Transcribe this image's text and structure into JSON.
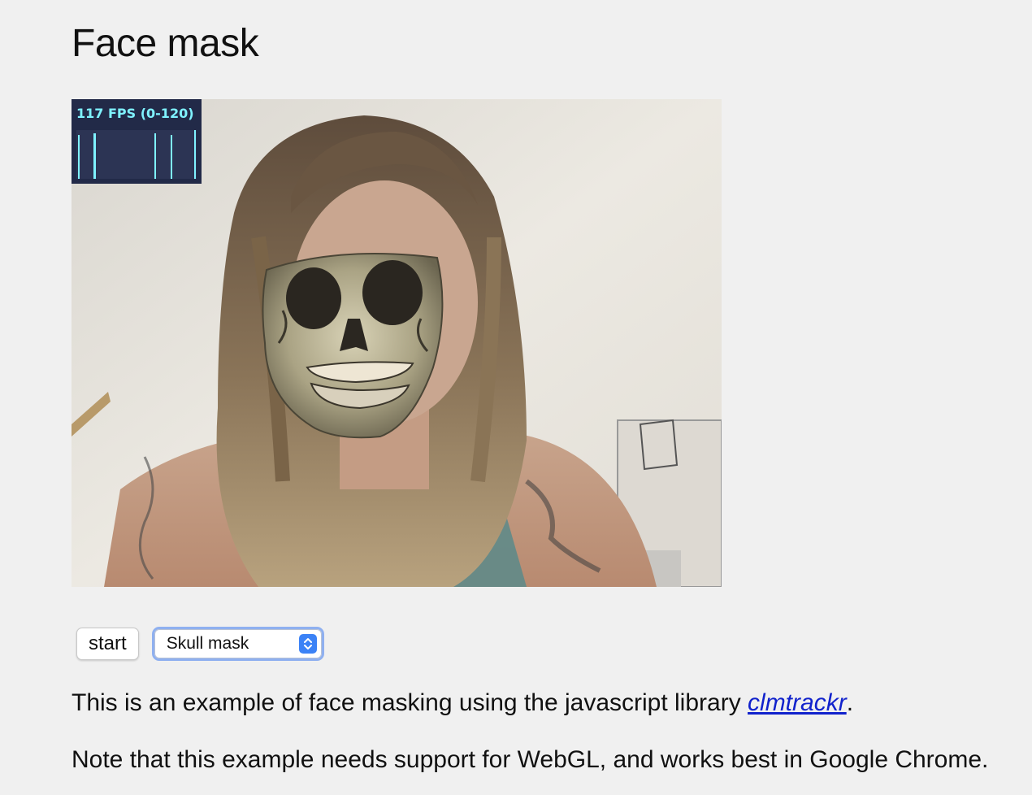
{
  "page": {
    "title": "Face mask"
  },
  "video": {
    "stats": {
      "fps_label": "117 FPS (0-120)",
      "accent_color": "#7ff2ff",
      "background_color": "#222a48"
    }
  },
  "controls": {
    "start_label": "start",
    "mask_select": {
      "selected": "Skull mask",
      "icon": "select-arrows-icon"
    }
  },
  "description": {
    "line1_prefix": "This is an example of face masking using the javascript library ",
    "line1_link": "clmtrackr",
    "line1_suffix": ".",
    "line2": "Note that this example needs support for WebGL, and works best in Google Chrome."
  }
}
